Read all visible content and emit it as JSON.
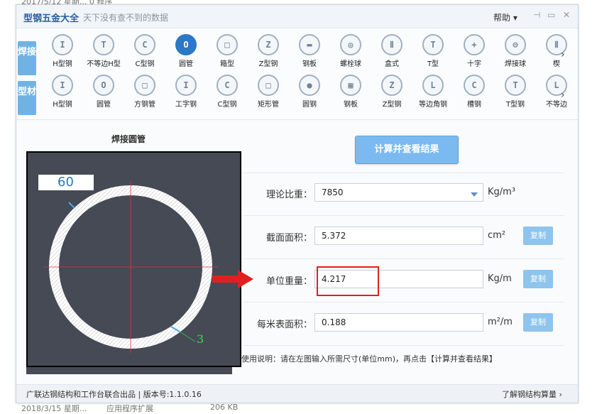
{
  "background": {
    "top_text": "2017/5/12 星期...      0 程序",
    "bottom_date": "2018/3/15 星期...",
    "bottom_type": "应用程序扩展",
    "bottom_size": "206 KB"
  },
  "titlebar": {
    "title": "型钢五金大全",
    "subtitle": "天下没有查不到的数据",
    "help_label": "帮助 ▾",
    "controls": [
      "pin-icon",
      "minimize-icon",
      "close-icon"
    ]
  },
  "toolbar": {
    "row1": {
      "tab": "焊接",
      "items": [
        {
          "label": "H型钢",
          "icon": "h-beam-icon",
          "glyph": "I"
        },
        {
          "label": "不等边H型",
          "icon": "unequal-h-beam-icon",
          "glyph": "T"
        },
        {
          "label": "C型钢",
          "icon": "c-channel-icon",
          "glyph": "C"
        },
        {
          "label": "圆管",
          "icon": "round-tube-icon",
          "glyph": "O",
          "active": true
        },
        {
          "label": "箱型",
          "icon": "box-section-icon",
          "glyph": "□"
        },
        {
          "label": "Z型钢",
          "icon": "z-section-icon",
          "glyph": "Z"
        },
        {
          "label": "钢板",
          "icon": "steel-plate-icon",
          "glyph": "▬"
        },
        {
          "label": "螺栓球",
          "icon": "bolt-ball-icon",
          "glyph": "◎"
        },
        {
          "label": "盒式",
          "icon": "box-type-icon",
          "glyph": "Ⅱ"
        },
        {
          "label": "T型",
          "icon": "t-section-icon",
          "glyph": "T"
        },
        {
          "label": "十字",
          "icon": "cross-section-icon",
          "glyph": "+"
        },
        {
          "label": "焊接球",
          "icon": "welded-ball-icon",
          "glyph": "⊖"
        },
        {
          "label": "楔",
          "icon": "wedge-icon",
          "glyph": "Ⅱ"
        }
      ]
    },
    "row2": {
      "tab": "型材",
      "items": [
        {
          "label": "H型钢",
          "icon": "h-beam-icon",
          "glyph": "I"
        },
        {
          "label": "圆管",
          "icon": "round-tube-icon",
          "glyph": "O"
        },
        {
          "label": "方钢管",
          "icon": "square-tube-icon",
          "glyph": "□"
        },
        {
          "label": "工字钢",
          "icon": "i-beam-icon",
          "glyph": "I"
        },
        {
          "label": "C型钢",
          "icon": "c-channel-icon",
          "glyph": "C"
        },
        {
          "label": "矩形管",
          "icon": "rect-tube-icon",
          "glyph": "□"
        },
        {
          "label": "圆钢",
          "icon": "round-bar-icon",
          "glyph": "●"
        },
        {
          "label": "钢板",
          "icon": "steel-plate-icon",
          "glyph": "▦"
        },
        {
          "label": "Z型钢",
          "icon": "z-section-icon",
          "glyph": "Z"
        },
        {
          "label": "等边角钢",
          "icon": "equal-angle-icon",
          "glyph": "L"
        },
        {
          "label": "槽钢",
          "icon": "channel-icon",
          "glyph": "C"
        },
        {
          "label": "T型钢",
          "icon": "t-section-icon",
          "glyph": "T"
        },
        {
          "label": "不等边",
          "icon": "unequal-angle-icon",
          "glyph": "L"
        }
      ]
    }
  },
  "main": {
    "section_title": "焊接圆管",
    "calc_button": "计算并查看结果",
    "diagram": {
      "diameter": "60",
      "thickness": "3"
    },
    "fields": [
      {
        "label": "理论比重：",
        "value": "7850",
        "unit": "Kg/m³",
        "dropdown": true
      },
      {
        "label": "截面面积：",
        "value": "5.372",
        "unit": "cm²",
        "copy": "复制"
      },
      {
        "label": "单位重量：",
        "value": "4.217",
        "unit": "Kg/m",
        "copy": "复制"
      },
      {
        "label": "每米表面积：",
        "value": "0.188",
        "unit": "m²/m",
        "copy": "复制"
      }
    ],
    "instruction": "使用说明：请在左图输入所需尺寸(单位mm)，再点击【计算并查看结果】"
  },
  "statusbar": {
    "left": "广联达钢结构和工作台联合出品 | 版本号:1.1.0.16",
    "right": "了解钢结构算量 ›"
  },
  "colors": {
    "accent": "#2a78c6",
    "button": "#7bbaf0",
    "highlight": "#e02020"
  }
}
